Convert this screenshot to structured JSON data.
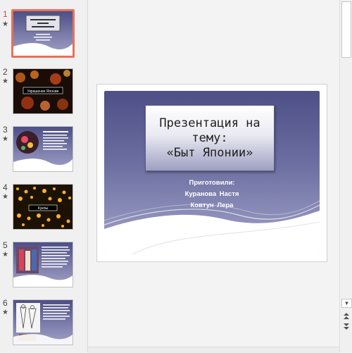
{
  "thumbnails": [
    {
      "number": "1",
      "star": "★",
      "active": true
    },
    {
      "number": "2",
      "star": "★",
      "caption": "Украшение Японии"
    },
    {
      "number": "3",
      "star": "★"
    },
    {
      "number": "4",
      "star": "★",
      "caption": "Куклы"
    },
    {
      "number": "5",
      "star": "★"
    },
    {
      "number": "6",
      "star": "★"
    }
  ],
  "slide": {
    "title": "Презентация на\nтему:\n«Быт Японии»",
    "prepared_label": "Приготовили:",
    "author1": "Куранова  Настя",
    "author2": "Ковтун  Лера"
  },
  "scrollbar": {
    "down_icon": "▼",
    "prev_icon": "▲",
    "next_icon": "▼"
  }
}
